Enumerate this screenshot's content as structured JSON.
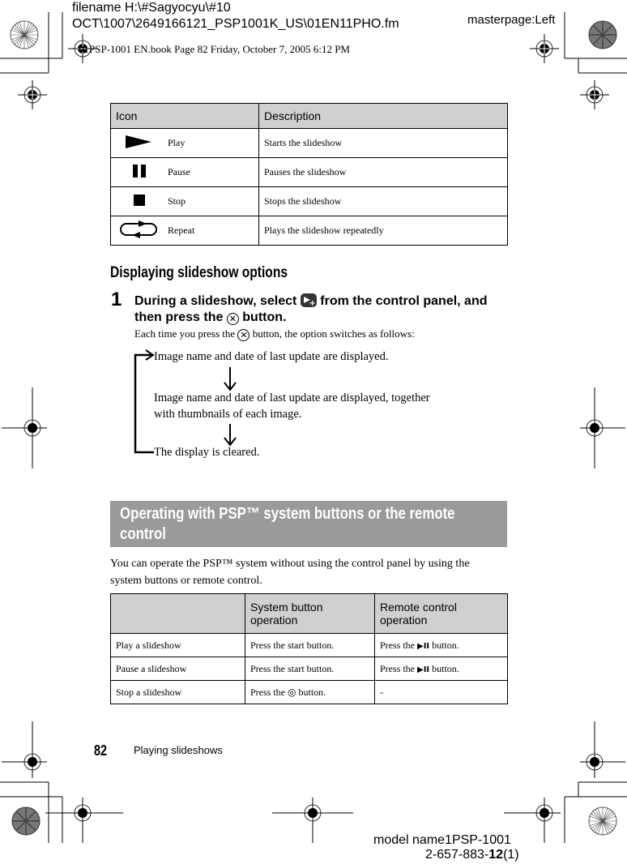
{
  "header": {
    "filename_line1": "filename H:\\#Sagyocyu\\#10",
    "filename_line2": "OCT\\1007\\2649166121_PSP1001K_US\\01EN11PHO.fm",
    "masterpage": "masterpage:Left",
    "book_info": "01PSP-1001 EN.book  Page 82  Friday, October 7, 2005  6:12 PM"
  },
  "icon_table": {
    "headers": [
      "Icon",
      "Description"
    ],
    "rows": [
      {
        "icon": "play-icon",
        "name": "Play",
        "description": "Starts the slideshow"
      },
      {
        "icon": "pause-icon",
        "name": "Pause",
        "description": "Pauses the slideshow"
      },
      {
        "icon": "stop-icon",
        "name": "Stop",
        "description": "Stops the slideshow"
      },
      {
        "icon": "repeat-icon",
        "name": "Repeat",
        "description": "Plays the slideshow repeatedly"
      }
    ]
  },
  "options_section": {
    "heading": "Displaying slideshow options",
    "step_number": "1",
    "step_text_a": "During a slideshow, select",
    "step_text_b": "from the control panel, and then press the",
    "step_text_c": "button.",
    "sub_a": "Each time you press the",
    "sub_b": "button, the option switches as follows:",
    "cross_symbol": "✕",
    "flow": [
      "Image name and date of last update are displayed.",
      "Image name and date of last update are displayed, together",
      "with thumbnails of each image.",
      "The display is cleared."
    ]
  },
  "operating_section": {
    "title_line1": "Operating with PSP™ system buttons or the remote",
    "title_line2": "control",
    "intro_line1": "You can operate the PSP™ system without using the control panel by using the",
    "intro_line2": "system buttons or remote control.",
    "table": {
      "headers": [
        "",
        "System button operation",
        "Remote control operation"
      ],
      "rows": [
        {
          "action": "Play a slideshow",
          "system": "Press the start button.",
          "remote_a": "Press the",
          "remote_icon": "▶II",
          "remote_b": "button."
        },
        {
          "action": "Pause a slideshow",
          "system": "Press the start button.",
          "remote_a": "Press the",
          "remote_icon": "▶II",
          "remote_b": "button."
        },
        {
          "action": "Stop a slideshow",
          "system_a": "Press the",
          "system_icon": "◎",
          "system_b": "button.",
          "remote": "-"
        }
      ]
    }
  },
  "footer": {
    "page_number": "82",
    "section_title": "Playing slideshows",
    "model_line1": "model name1PSP-1001",
    "model_line2_a": "2-657-883-",
    "model_line2_b": "12",
    "model_line2_c": "(1)"
  }
}
